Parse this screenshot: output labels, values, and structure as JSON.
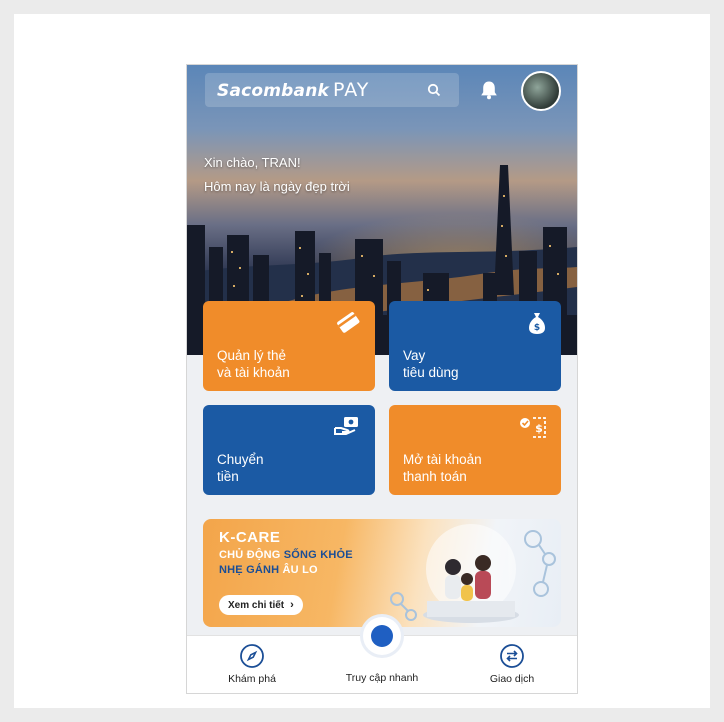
{
  "header": {
    "brand": "Sacombank",
    "brand_pay": "PAY"
  },
  "greeting": {
    "hello": "Xin chào, TRAN!",
    "subtitle": "Hôm nay là ngày đẹp trời"
  },
  "tiles": [
    {
      "label": "Quản lý thẻ\nvà tài khoản",
      "icon": "card-icon",
      "color": "#f08c2a"
    },
    {
      "label": "Vay\ntiêu dùng",
      "icon": "money-bag-icon",
      "color": "#1b5aa4"
    },
    {
      "label": "Chuyển\ntiền",
      "icon": "transfer-hand-icon",
      "color": "#1b5aa4"
    },
    {
      "label": "Mở tài khoản\nthanh toán",
      "icon": "open-account-icon",
      "color": "#f08c2a"
    }
  ],
  "banner": {
    "title": "K-CARE",
    "line1_pre": "CHỦ ĐỘNG ",
    "line1_hl": "SỐNG KHỎE",
    "line2_hl": "NHẸ GÁNH",
    "line2_post": " ÂU LO",
    "cta": "Xem chi tiết"
  },
  "nav": {
    "explore": "Khám phá",
    "quick": "Truy cập nhanh",
    "transactions": "Giao dịch"
  },
  "colors": {
    "orange": "#f08c2a",
    "blue": "#1b5aa4",
    "accent_blue": "#1f5fc2"
  }
}
